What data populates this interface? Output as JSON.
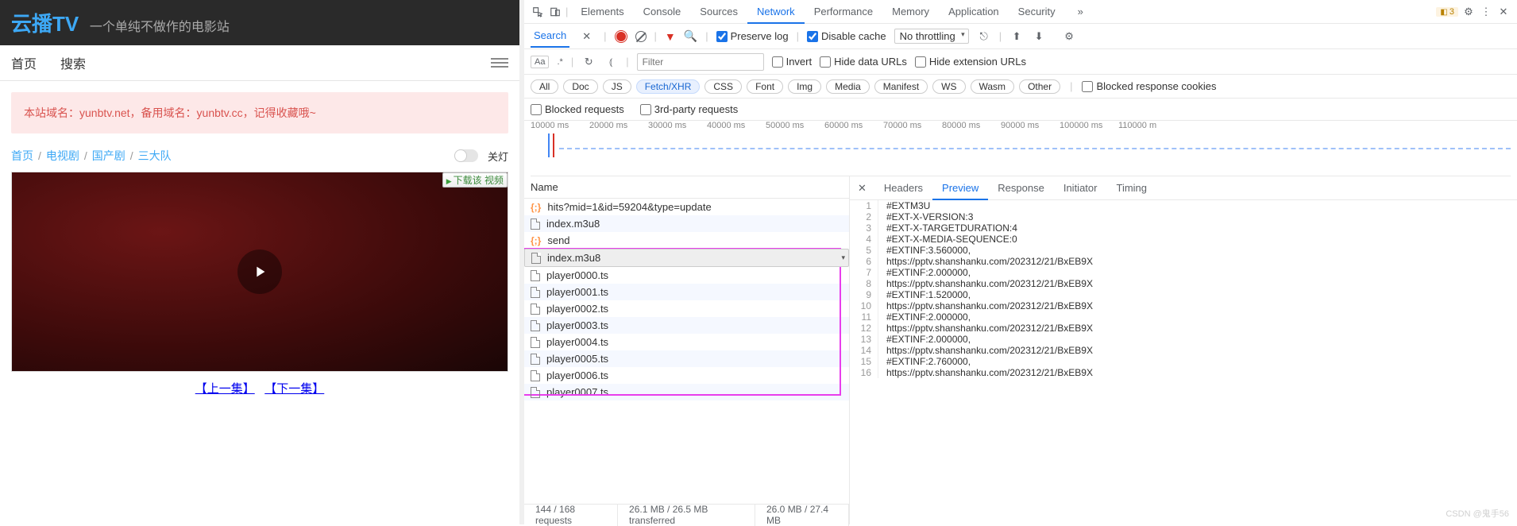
{
  "site": {
    "logo": "云播TV",
    "tagline": "一个单纯不做作的电影站",
    "nav": {
      "home": "首页",
      "search": "搜索"
    },
    "alert": "本站域名：yunbtv.net，备用域名：yunbtv.cc，记得收藏哦~",
    "crumbs": {
      "home": "首页",
      "tvshow": "电视剧",
      "domestic": "国产剧",
      "title": "三大队"
    },
    "lights_off": "关灯",
    "download": "下载该 视频",
    "prev_ep": "【上一集】",
    "next_ep": "【下一集】"
  },
  "devtools": {
    "tabs": [
      "Elements",
      "Console",
      "Sources",
      "Network",
      "Performance",
      "Memory",
      "Application",
      "Security"
    ],
    "active_tab": "Network",
    "more": "»",
    "warn_count": "3",
    "search_label": "Search",
    "preserve_log": "Preserve log",
    "disable_cache": "Disable cache",
    "throttling": "No throttling",
    "filter_placeholder": "Filter",
    "options": {
      "invert": "Invert",
      "hide_data": "Hide data URLs",
      "hide_ext": "Hide extension URLs",
      "blocked_cookies": "Blocked response cookies",
      "blocked_requests": "Blocked requests",
      "third_party": "3rd-party requests"
    },
    "filter_chips": [
      "All",
      "Doc",
      "JS",
      "Fetch/XHR",
      "CSS",
      "Font",
      "Img",
      "Media",
      "Manifest",
      "WS",
      "Wasm",
      "Other"
    ],
    "active_chip": "Fetch/XHR",
    "timeline_ticks": [
      "10000 ms",
      "20000 ms",
      "30000 ms",
      "40000 ms",
      "50000 ms",
      "60000 ms",
      "70000 ms",
      "80000 ms",
      "90000 ms",
      "100000 ms",
      "110000 m"
    ],
    "name_header": "Name",
    "requests": [
      {
        "name": "hits?mid=1&id=59204&type=update",
        "kind": "xhr"
      },
      {
        "name": "index.m3u8",
        "kind": "doc"
      },
      {
        "name": "send",
        "kind": "xhr"
      },
      {
        "name": "index.m3u8",
        "kind": "doc",
        "selected": true
      },
      {
        "name": "player0000.ts",
        "kind": "doc"
      },
      {
        "name": "player0001.ts",
        "kind": "doc"
      },
      {
        "name": "player0002.ts",
        "kind": "doc"
      },
      {
        "name": "player0003.ts",
        "kind": "doc"
      },
      {
        "name": "player0004.ts",
        "kind": "doc"
      },
      {
        "name": "player0005.ts",
        "kind": "doc"
      },
      {
        "name": "player0006.ts",
        "kind": "doc"
      },
      {
        "name": "player0007.ts",
        "kind": "doc"
      }
    ],
    "detail_tabs": [
      "Headers",
      "Preview",
      "Response",
      "Initiator",
      "Timing"
    ],
    "active_detail": "Preview",
    "code_lines": [
      "#EXTM3U",
      "#EXT-X-VERSION:3",
      "#EXT-X-TARGETDURATION:4",
      "#EXT-X-MEDIA-SEQUENCE:0",
      "#EXTINF:3.560000,",
      "https://pptv.shanshanku.com/202312/21/BxEB9X",
      "#EXTINF:2.000000,",
      "https://pptv.shanshanku.com/202312/21/BxEB9X",
      "#EXTINF:1.520000,",
      "https://pptv.shanshanku.com/202312/21/BxEB9X",
      "#EXTINF:2.000000,",
      "https://pptv.shanshanku.com/202312/21/BxEB9X",
      "#EXTINF:2.000000,",
      "https://pptv.shanshanku.com/202312/21/BxEB9X",
      "#EXTINF:2.760000,",
      "https://pptv.shanshanku.com/202312/21/BxEB9X"
    ],
    "status": {
      "requests": "144 / 168 requests",
      "transferred": "26.1 MB / 26.5 MB transferred",
      "resources": "26.0 MB / 27.4 MB"
    },
    "watermark": "CSDN @鬼手56"
  }
}
